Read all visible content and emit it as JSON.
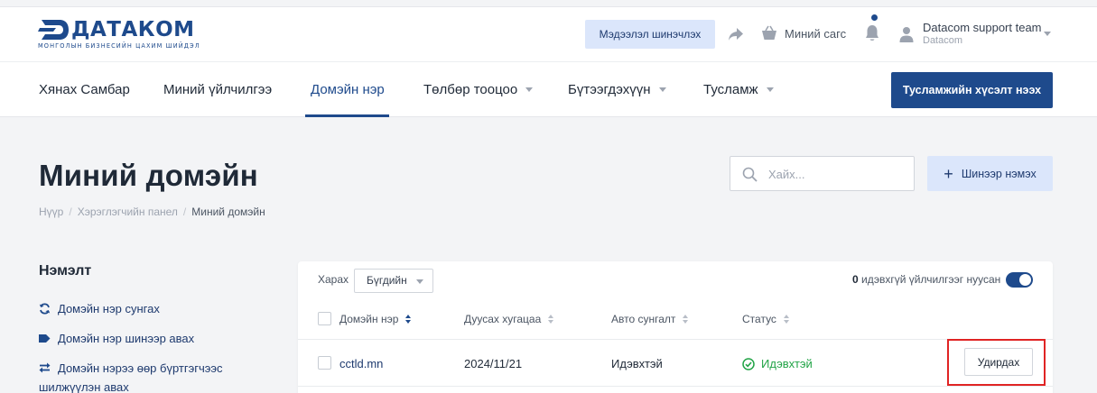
{
  "header": {
    "logo_text": "ДАТАКОМ",
    "logo_tagline": "МОНГОЛЫН БИЗНЕСИЙН ЦАХИМ ШИЙДЭЛ",
    "update_button": "Мэдээлэл шинэчлэх",
    "basket_label": "Миний сагс",
    "user_name": "Datacom support team",
    "user_org": "Datacom",
    "brand_color": "#1e4a8c"
  },
  "nav": {
    "items": [
      {
        "label": "Хянах Самбар"
      },
      {
        "label": "Миний үйлчилгээ"
      },
      {
        "label": "Домэйн нэр"
      },
      {
        "label": "Төлбөр тооцоо"
      },
      {
        "label": "Бүтээгдэхүүн"
      },
      {
        "label": "Тусламж"
      }
    ],
    "active_index": 2,
    "help_request_button": "Тусламжийн хүсэлт нээх"
  },
  "page": {
    "title": "Миний домэйн",
    "breadcrumb": [
      "Нүүр",
      "Хэрэглэгчийн панел",
      "Миний домэйн"
    ],
    "search_placeholder": "Хайх...",
    "add_button": "Шинээр нэмэх"
  },
  "sidebar": {
    "title": "Нэмэлт",
    "items": [
      {
        "icon": "refresh-icon",
        "label": "Домэйн нэр сунгах"
      },
      {
        "icon": "tag-icon",
        "label": "Домэйн нэр шинээр авах"
      },
      {
        "icon": "transfer-icon",
        "label_line1": "Домэйн нэрээ өөр бүртгэгчээс",
        "label_line2": "шилжүүлэн авах"
      }
    ]
  },
  "table": {
    "filter_label": "Харах",
    "filter_value": "Бүгдийн",
    "hidden_count": "0",
    "hidden_text": "идэвхгүй үйлчилгээг нуусан",
    "hide_inactive_enabled": true,
    "columns": [
      "Домэйн нэр",
      "Дуусах хугацаа",
      "Авто сунгалт",
      "Статус"
    ],
    "rows": [
      {
        "domain": "cctld.mn",
        "expires": "2024/11/21",
        "auto_renew": "Идэвхтэй",
        "status": "Идэвхтэй",
        "status_color": "#22a447",
        "action": "Удирдах"
      }
    ]
  }
}
